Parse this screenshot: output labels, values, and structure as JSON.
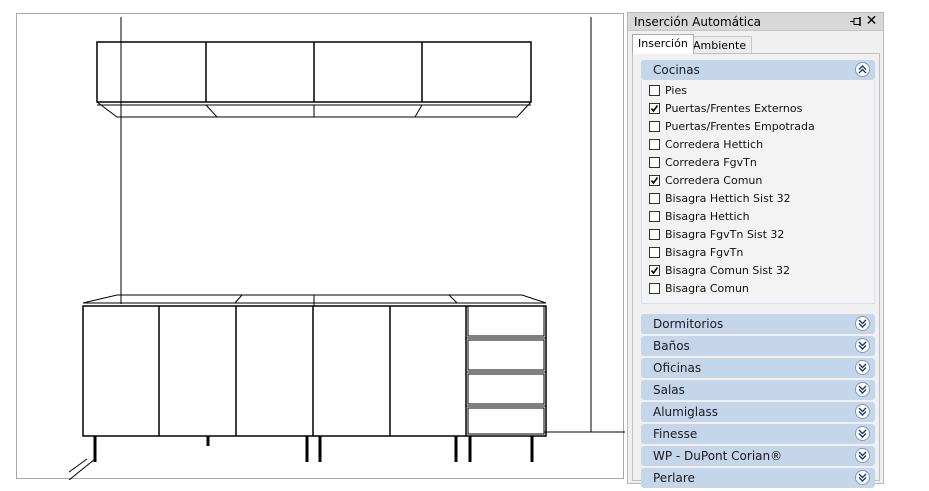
{
  "panel": {
    "title": "Inserción Automática",
    "tabs": [
      {
        "label": "Inserción",
        "active": true
      },
      {
        "label": "Ambiente",
        "active": false
      }
    ]
  },
  "groups": {
    "cocinas": {
      "label": "Cocinas",
      "expanded": true,
      "items": [
        {
          "label": "Pies",
          "checked": false
        },
        {
          "label": "Puertas/Frentes Externos",
          "checked": true
        },
        {
          "label": "Puertas/Frentes Empotrada",
          "checked": false
        },
        {
          "label": "Corredera Hettich",
          "checked": false
        },
        {
          "label": "Corredera FgvTn",
          "checked": false
        },
        {
          "label": "Corredera Comun",
          "checked": true
        },
        {
          "label": "Bisagra Hettich Sist 32",
          "checked": false
        },
        {
          "label": "Bisagra Hettich",
          "checked": false
        },
        {
          "label": "Bisagra FgvTn Sist 32",
          "checked": false
        },
        {
          "label": "Bisagra FgvTn",
          "checked": false
        },
        {
          "label": "Bisagra Comun Sist 32",
          "checked": true
        },
        {
          "label": "Bisagra Comun",
          "checked": false
        }
      ]
    },
    "collapsed": [
      {
        "label": "Dormitorios"
      },
      {
        "label": "Baños"
      },
      {
        "label": "Oficinas"
      },
      {
        "label": "Salas"
      },
      {
        "label": "Alumiglass"
      },
      {
        "label": "Finesse"
      },
      {
        "label": "WP - DuPont Corian®"
      },
      {
        "label": "Perlare"
      }
    ]
  },
  "icons": {
    "pin": "pin-icon",
    "close": "close-icon",
    "expand": "chevron-double-down-icon",
    "collapse": "chevron-double-up-icon"
  },
  "colors": {
    "group_header": "#c5d5ea",
    "panel_bg": "#f0f0f0"
  }
}
